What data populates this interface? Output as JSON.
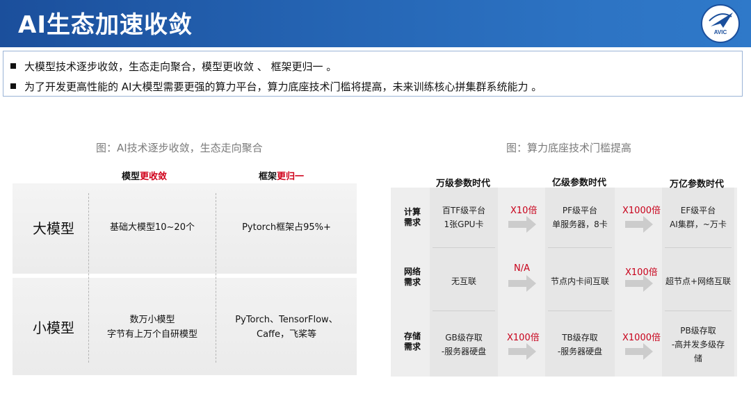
{
  "header": {
    "title": "AI生态加速收敛",
    "logo_text": "AVIC"
  },
  "bullets": [
    "大模型技术逐步收敛，生态走向聚合，模型更收敛 、 框架更归一 。",
    "为了开发更高性能的 AI大模型需要更强的算力平台，算力底座技术门槛将提高，未来训练核心拼集群系统能力 。"
  ],
  "left_figure": {
    "caption": "图：AI技术逐步收敛，生态走向聚合",
    "col1_head": {
      "black": "模型",
      "red": "更收敛"
    },
    "col2_head": {
      "black": "框架",
      "red": "更归一"
    },
    "rows": [
      {
        "label": "大模型",
        "model": [
          "基础大模型10~20个"
        ],
        "framework": [
          "Pytorch框架占95%+"
        ]
      },
      {
        "label": "小模型",
        "model": [
          "数万小模型",
          "字节有上万个自研模型"
        ],
        "framework": [
          "PyTorch、TensorFlow、",
          "Caffe，飞桨等"
        ]
      }
    ]
  },
  "right_figure": {
    "caption": "图：算力底座技术门槛提高",
    "eras": [
      "万级参数时代",
      "亿级参数时代",
      "万亿参数时代"
    ],
    "rows": [
      {
        "head": [
          "计算",
          "需求"
        ],
        "cells": [
          [
            "百TF级平台",
            "1张GPU卡"
          ],
          [
            "PF级平台",
            "单服务器，8卡"
          ],
          [
            "EF级平台",
            "AI集群，~万卡"
          ]
        ],
        "multipliers": [
          "X10倍",
          "X1000倍"
        ]
      },
      {
        "head": [
          "网络",
          "需求"
        ],
        "cells": [
          [
            "无互联"
          ],
          [
            "节点内卡间互联"
          ],
          [
            "超节点+网络互联"
          ]
        ],
        "multipliers": [
          "N/A",
          "X100倍"
        ]
      },
      {
        "head": [
          "存储",
          "需求"
        ],
        "cells": [
          [
            "GB级存取",
            "-服务器硬盘"
          ],
          [
            "TB级存取",
            "-服务器硬盘"
          ],
          [
            "PB级存取",
            "-高并发多级存",
            "储"
          ]
        ],
        "multipliers": [
          "X100倍",
          "X1000倍"
        ]
      }
    ]
  },
  "colors": {
    "header_blue": "#1b4f9c",
    "accent_red": "#d0021b",
    "arrow_gray": "#c9c9c9"
  }
}
